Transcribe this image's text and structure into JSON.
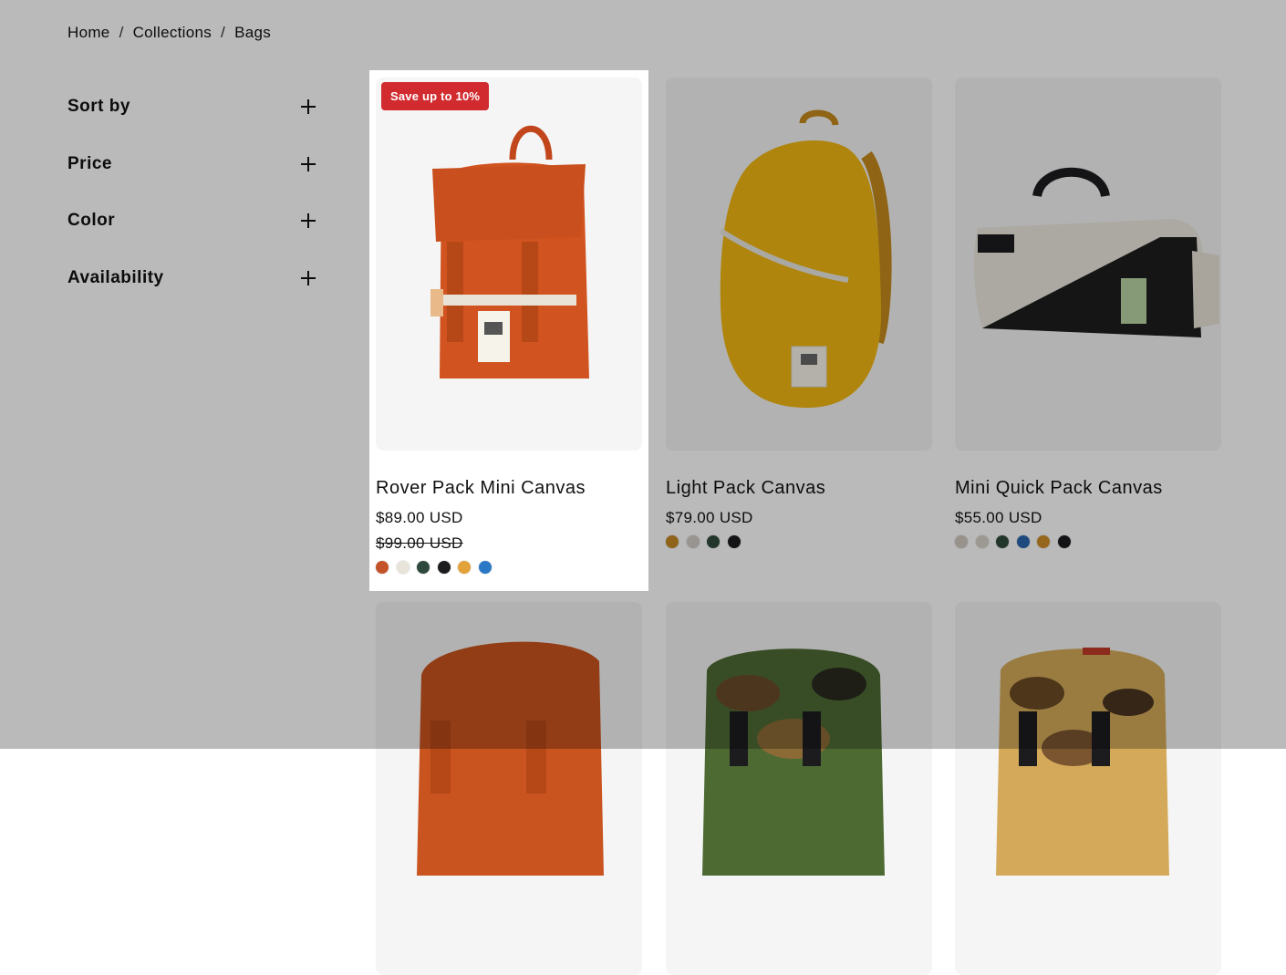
{
  "breadcrumb": {
    "items": [
      "Home",
      "Collections",
      "Bags"
    ],
    "separator": "/"
  },
  "filters": [
    {
      "label": "Sort by"
    },
    {
      "label": "Price"
    },
    {
      "label": "Color"
    },
    {
      "label": "Availability"
    }
  ],
  "products": [
    {
      "title": "Rover Pack Mini Canvas",
      "price": "$89.00 USD",
      "compare_price": "$99.00 USD",
      "badge": "Save up to 10%",
      "swatches": [
        "#c4532a",
        "#e9e4da",
        "#2f4a3d",
        "#1c1c1f",
        "#e3a23a",
        "#2a78c6"
      ]
    },
    {
      "title": "Light Pack Canvas",
      "price": "$79.00 USD",
      "swatches": [
        "#c48a24",
        "#d1cdc6",
        "#2f4a3d",
        "#1c1c1f"
      ]
    },
    {
      "title": "Mini Quick Pack Canvas",
      "price": "$55.00 USD",
      "swatches": [
        "#cfcac0",
        "#d6d2ca",
        "#2f4a3d",
        "#2a66ad",
        "#d08d29",
        "#1c1c1f"
      ]
    }
  ],
  "colors": {
    "overlay": "rgba(0,0,0,0.27)",
    "badge": "#d12b2f",
    "card_bg": "#f5f5f5"
  }
}
